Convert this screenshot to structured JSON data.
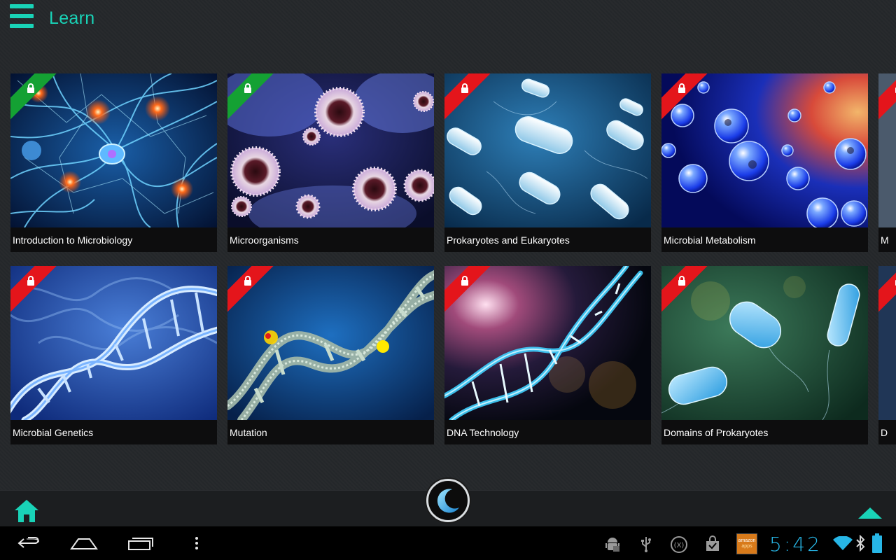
{
  "header": {
    "title": "Learn"
  },
  "cards": [
    {
      "label": "Introduction to Microbiology",
      "locked": true,
      "ribbon": "green"
    },
    {
      "label": "Microorganisms",
      "locked": true,
      "ribbon": "green"
    },
    {
      "label": "Prokaryotes and Eukaryotes",
      "locked": true,
      "ribbon": "red"
    },
    {
      "label": "Microbial Metabolism",
      "locked": true,
      "ribbon": "red"
    },
    {
      "label": "M",
      "locked": true,
      "ribbon": "red"
    },
    {
      "label": "Microbial Genetics",
      "locked": true,
      "ribbon": "red"
    },
    {
      "label": "Mutation",
      "locked": true,
      "ribbon": "red"
    },
    {
      "label": "DNA Technology",
      "locked": true,
      "ribbon": "red"
    },
    {
      "label": "Domains of Prokaryotes",
      "locked": true,
      "ribbon": "red"
    },
    {
      "label": "D",
      "locked": true,
      "ribbon": "red"
    }
  ],
  "status_bar": {
    "time": "5:42",
    "notification_icons": [
      "android-debug-icon",
      "usb-icon",
      "x-app-icon",
      "shopping-bag-icon",
      "amazon-appstore-icon"
    ],
    "amazon_badge_top": "amazon",
    "amazon_badge_bottom": "apps"
  },
  "colors": {
    "accent": "#19d3b7",
    "ribbon_green": "#14a133",
    "ribbon_red": "#e4151b",
    "clock": "#27b6e6"
  }
}
